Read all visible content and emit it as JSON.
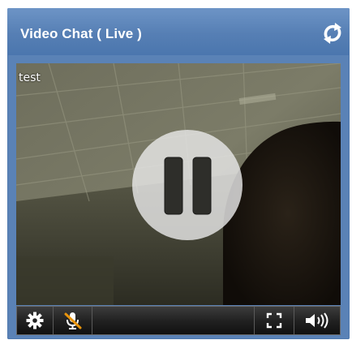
{
  "window": {
    "title": "Video Chat ( Live )"
  },
  "video": {
    "label": "test"
  },
  "icons": {
    "refresh": "refresh-icon",
    "pause": "pause-icon",
    "settings": "gear-icon",
    "mic": "microphone-muted-icon",
    "fullscreen": "fullscreen-icon",
    "volume": "speaker-icon"
  },
  "colors": {
    "titlebar": "#567fb4",
    "frame": "#5a82b6",
    "controlbar": "#222222",
    "mute_accent": "#e8940c"
  }
}
